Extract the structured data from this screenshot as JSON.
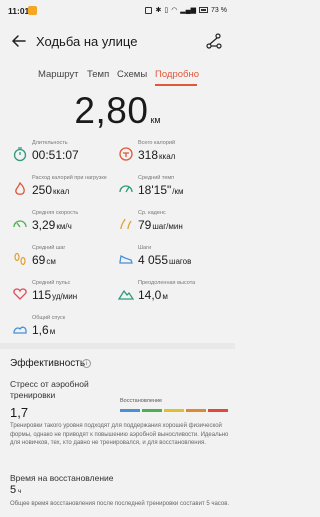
{
  "status_bar": {
    "time": "11:01",
    "battery": "73 %"
  },
  "header": {
    "title": "Ходьба на улице"
  },
  "tabs": [
    {
      "label": "Маршрут"
    },
    {
      "label": "Темп"
    },
    {
      "label": "Схемы"
    },
    {
      "label": "Подробно"
    }
  ],
  "distance": {
    "value": "2,80",
    "unit": "км"
  },
  "stats": [
    {
      "label": "Длительность",
      "value": "00:51:07",
      "unit": "",
      "icon": "stopwatch-icon",
      "color": "#2f9a7c"
    },
    {
      "label": "Всего калорий",
      "value": "318",
      "unit": "ккал",
      "icon": "calories-icon",
      "color": "#e0573a"
    },
    {
      "label": "Расход калорий при нагрузке",
      "value": "250",
      "unit": "ккал",
      "icon": "flame-icon",
      "color": "#e0573a"
    },
    {
      "label": "Средний темп",
      "value": "18'15\"",
      "unit": "/км",
      "icon": "pace-icon",
      "color": "#2f9a7c"
    },
    {
      "label": "Средняя скорость",
      "value": "3,29",
      "unit": "км/ч",
      "icon": "speed-icon",
      "color": "#4caf50"
    },
    {
      "label": "Ср. каденс",
      "value": "79",
      "unit": "шаг/мин",
      "icon": "cadence-icon",
      "color": "#e0a030"
    },
    {
      "label": "Средний шаг",
      "value": "69",
      "unit": "см",
      "icon": "footsteps-icon",
      "color": "#e0a030"
    },
    {
      "label": "Шаги",
      "value": "4 055",
      "unit": "шагов",
      "icon": "shoe-icon",
      "color": "#4a90d9"
    },
    {
      "label": "Средний пульс",
      "value": "115",
      "unit": "уд/мин",
      "icon": "heart-icon",
      "color": "#e04a5a"
    },
    {
      "label": "Преодоленная высота",
      "value": "14,0",
      "unit": "м",
      "icon": "mountain-icon",
      "color": "#2f9a7c"
    },
    {
      "label": "Общий спуск",
      "value": "1,6",
      "unit": "м",
      "icon": "descent-icon",
      "color": "#4a90d9"
    }
  ],
  "efficiency": {
    "title": "Эффективность",
    "stress_label": "Стресс от аэробной тренировки",
    "stress_value": "1,7",
    "scale_label": "Восстановление",
    "scale_colors": [
      "#4a90d9",
      "#4caf50",
      "#e0c030",
      "#e08a30",
      "#e04a3a"
    ],
    "description": "Тренировки такого уровня подходят для поддержания хорошей физической формы, однако не приводят к повышению аэробной выносливости. Идеально для новичков, тех, кто давно не тренировался, и для восстановления.",
    "recovery_title": "Время на восстановление",
    "recovery_value": "5",
    "recovery_unit": "ч",
    "recovery_desc": "Общее время восстановления после последней тренировки составит 5 часов."
  }
}
